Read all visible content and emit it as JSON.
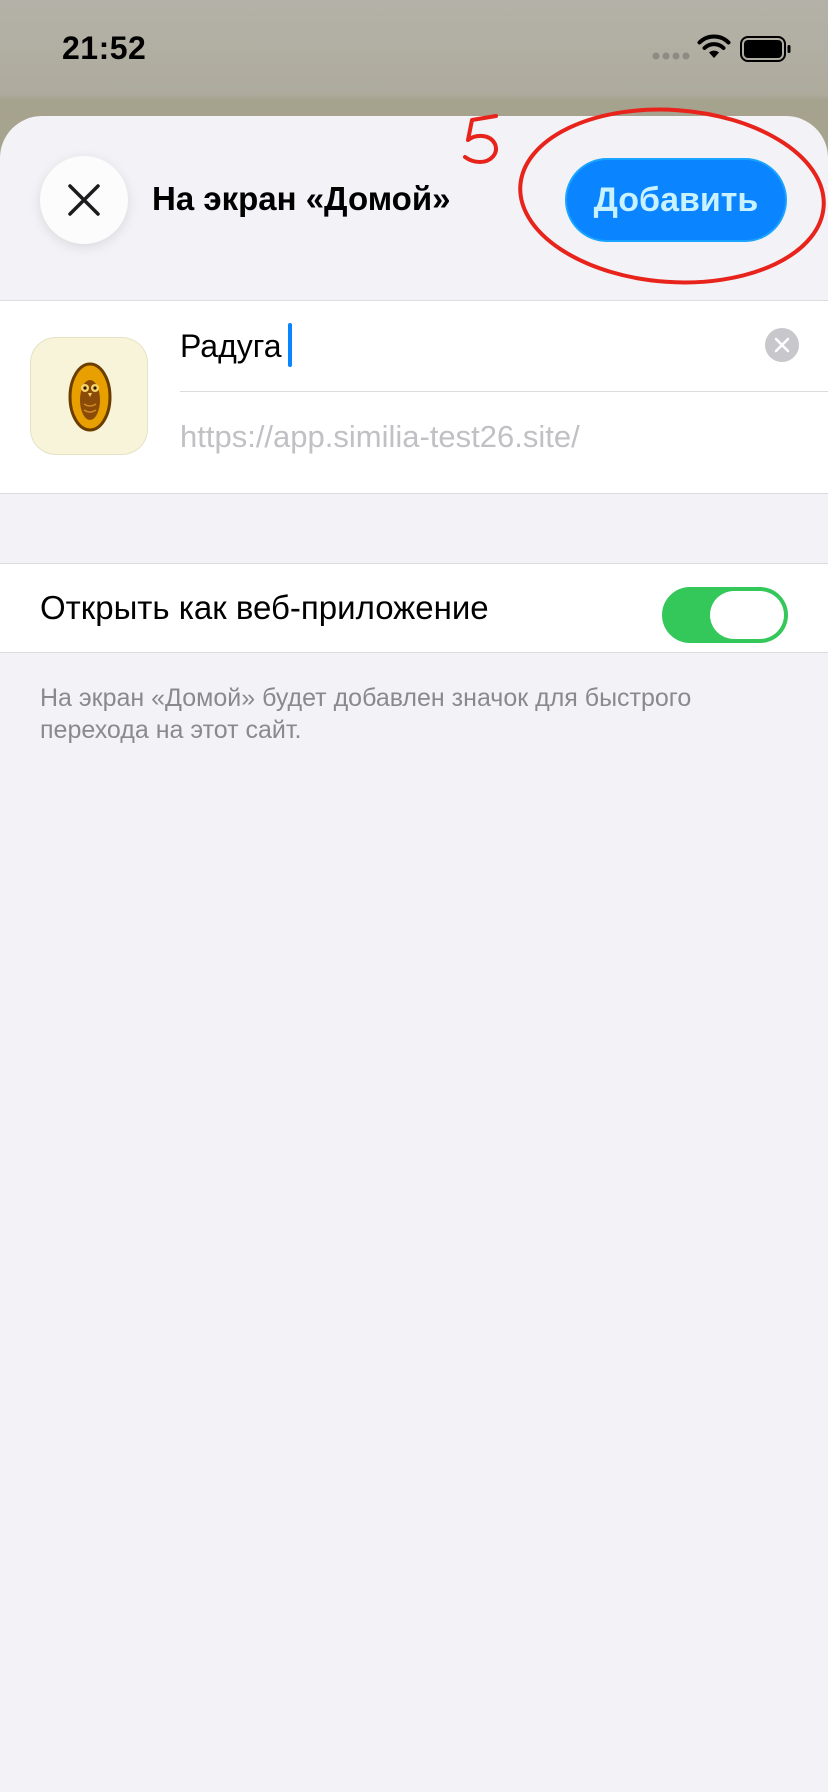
{
  "status_bar": {
    "time": "21:52",
    "icons": [
      "cellular-signal-icon",
      "wifi-icon",
      "battery-icon"
    ]
  },
  "sheet": {
    "title": "На экран «Домой»",
    "close_icon": "close-icon",
    "add_label": "Добавить"
  },
  "app_entry": {
    "icon": "owl-app-icon",
    "name_value": "Радуга",
    "url": "https://app.similia-test26.site/",
    "clear_icon": "clear-text-icon"
  },
  "web_app_toggle": {
    "label": "Открыть как веб-приложение",
    "on": true
  },
  "footnote": "На экран «Домой» будет добавлен значок для быстрого перехода на этот сайт.",
  "annotation": {
    "step_number": "5",
    "color": "#e8231b"
  },
  "colors": {
    "accent": "#0a84ff",
    "toggle_on": "#34c759",
    "sheet_bg": "#f2f2f7"
  }
}
